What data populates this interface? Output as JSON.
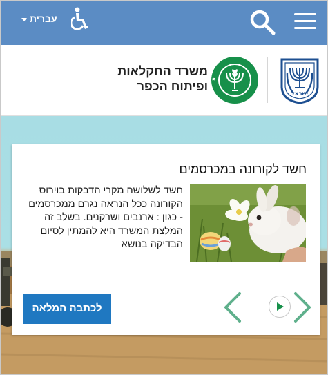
{
  "topbar": {
    "language_label": "עברית",
    "icons": {
      "accessibility": "accessibility-icon",
      "search": "search-icon",
      "menu": "hamburger-menu-icon",
      "language_caret": "caret-down-icon"
    }
  },
  "header": {
    "ministry_name_line1": "משרד החקלאות",
    "ministry_name_line2": "ופיתוח הכפר",
    "emblem_caption": "ישראל",
    "logo_ring_text": "משרד החקלאות ופיתוח הכפר"
  },
  "article": {
    "title": "חשד לקורונה במכרסמים",
    "body": "חשד לשלושה מקרי הדבקות בוירוס הקורונה ככל הנראה נגרם ממכרסמים - כגון : ארנבים ושרקנים. בשלב זה המלצת המשרד היא להמתין לסיום הבדיקה בנושא",
    "image": "rabbit-photo",
    "read_more_label": "לכתבה המלאה"
  },
  "carousel": {
    "prev_icon": "chevron-left-icon",
    "next_icon": "chevron-right-icon",
    "play_icon": "play-icon"
  },
  "colors": {
    "topbar": "#5b8cc4",
    "button": "#1f78c1",
    "ministry_green": "#17904a",
    "arrow_green": "#5fb08c",
    "sky": "#a8dde4"
  }
}
